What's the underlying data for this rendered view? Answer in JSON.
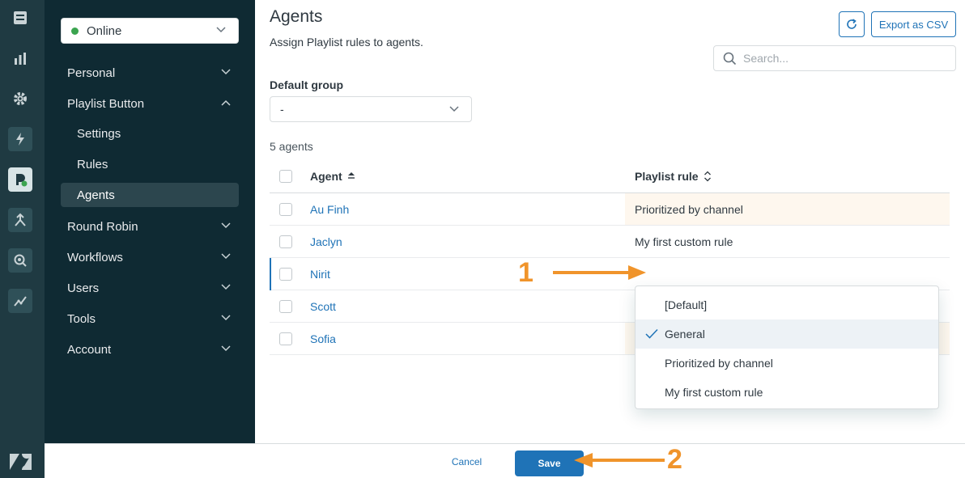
{
  "nav": {
    "status": "Online",
    "items": [
      {
        "label": "Personal"
      },
      {
        "label": "Playlist Button"
      },
      {
        "label": "Settings"
      },
      {
        "label": "Rules"
      },
      {
        "label": "Agents"
      },
      {
        "label": "Round Robin"
      },
      {
        "label": "Workflows"
      },
      {
        "label": "Users"
      },
      {
        "label": "Tools"
      },
      {
        "label": "Account"
      }
    ]
  },
  "rail_icons": [
    "inbox-icon",
    "bar-chart-icon",
    "gear-icon",
    "lightning-icon",
    "playlist-app-icon",
    "routing-icon",
    "search-zoom-icon",
    "trend-icon",
    "zendesk-logo-icon"
  ],
  "page": {
    "title": "Agents",
    "subtitle": "Assign Playlist rules to agents.",
    "export_label": "Export as CSV",
    "search_placeholder": "Search...",
    "default_group_label": "Default group",
    "default_group_value": "-",
    "agent_count": "5 agents"
  },
  "table": {
    "columns": [
      "Agent",
      "Playlist rule"
    ],
    "rows": [
      {
        "agent": "Au Finh",
        "rule": "Prioritized by channel"
      },
      {
        "agent": "Jaclyn",
        "rule": "My first custom rule"
      },
      {
        "agent": "Nirit",
        "rule": ""
      },
      {
        "agent": "Scott",
        "rule": ""
      },
      {
        "agent": "Sofia",
        "rule": ""
      }
    ]
  },
  "dropdown": {
    "options": [
      "[Default]",
      "General",
      "Prioritized by channel",
      "My first custom rule"
    ],
    "selected": "General"
  },
  "footer": {
    "cancel_label": "Cancel",
    "save_label": "Save"
  },
  "annotations": {
    "one": "1",
    "two": "2",
    "color": "#f0942b"
  },
  "colors": {
    "accent": "#1f73b7",
    "sidebar": "#0f2a33",
    "rail": "#1f3a42",
    "highlight_row": "#fef7ee",
    "online": "#3ba44f"
  }
}
